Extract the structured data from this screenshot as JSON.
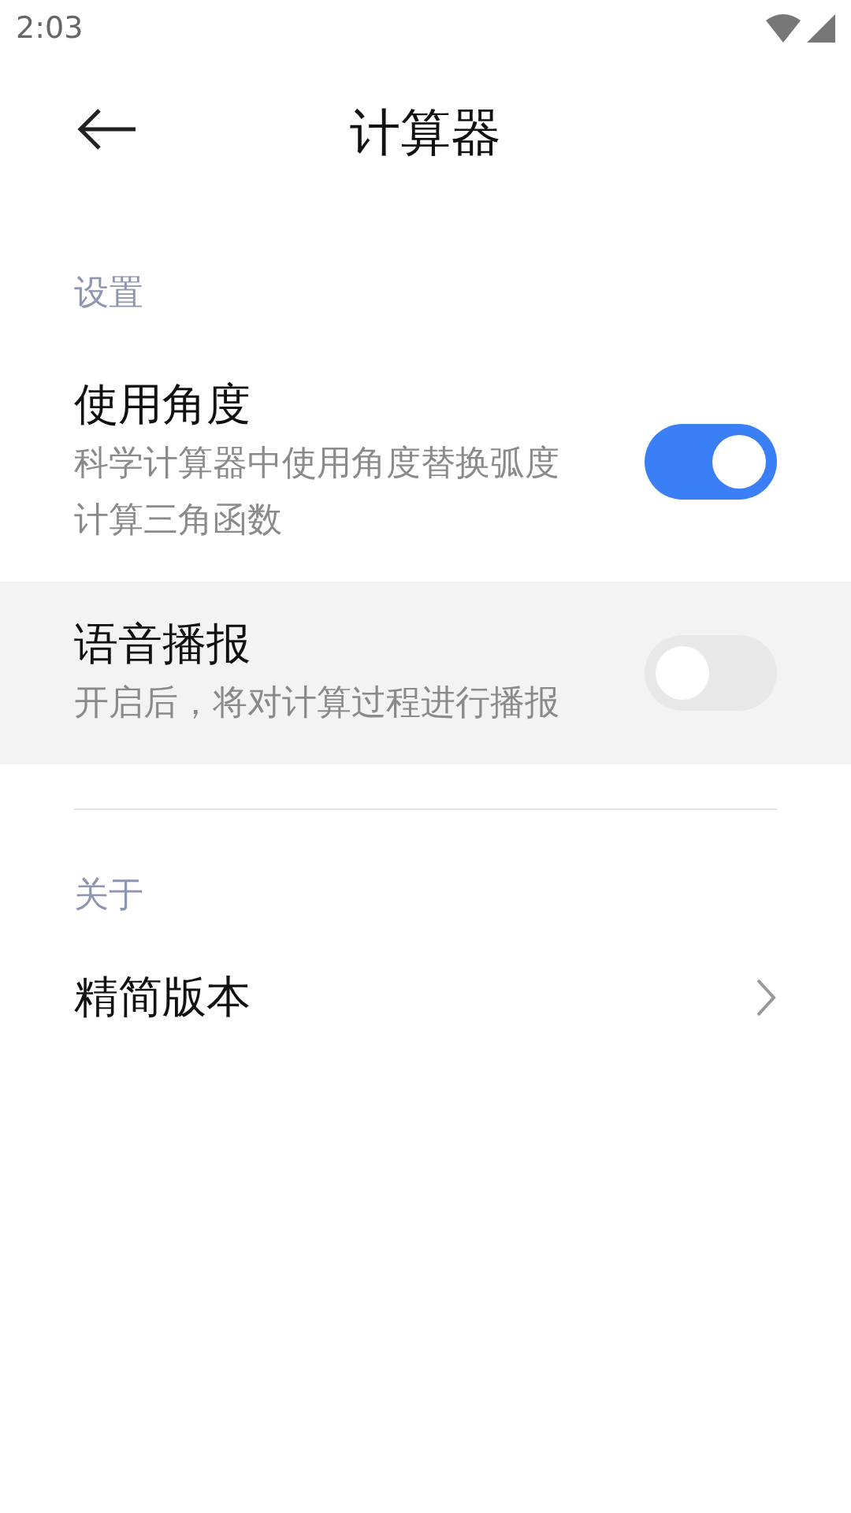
{
  "status_bar": {
    "time": "2:03"
  },
  "header": {
    "title": "计算器"
  },
  "sections": [
    {
      "title": "设置",
      "items": [
        {
          "kind": "toggle",
          "title": "使用角度",
          "subtitle": "科学计算器中使用角度替换弧度计算三角函数",
          "on": true,
          "selected": false
        },
        {
          "kind": "toggle",
          "title": "语音播报",
          "subtitle": "开启后，将对计算过程进行播报",
          "on": false,
          "selected": true
        }
      ]
    },
    {
      "title": "关于",
      "items": [
        {
          "kind": "link",
          "title": "精简版本",
          "selected": false
        }
      ]
    }
  ]
}
